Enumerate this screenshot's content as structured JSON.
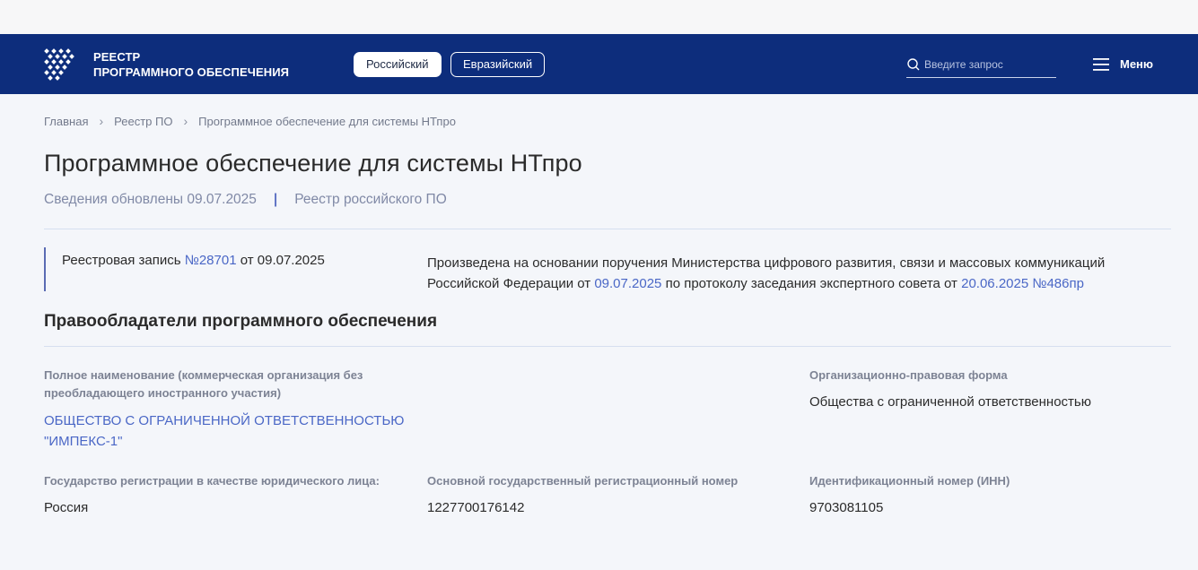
{
  "header": {
    "logo_text_line1": "РЕЕСТР",
    "logo_text_line2": "ПРОГРАММНОГО ОБЕСПЕЧЕНИЯ",
    "registry_tabs": [
      {
        "label": "Российский",
        "active": true
      },
      {
        "label": "Евразийский",
        "active": false
      }
    ],
    "search": {
      "placeholder": "Введите запрос",
      "value": ""
    },
    "menu_label": "Меню"
  },
  "breadcrumb": [
    "Главная",
    "Реестр ПО",
    "Программное обеспечение для системы НТпро"
  ],
  "page": {
    "title": "Программное обеспечение для системы НТпро",
    "updated": "Сведения обновлены 09.07.2025",
    "meta_divider": "|",
    "registry_name": "Реестр российского ПО"
  },
  "record": {
    "prefix": "Реестровая запись ",
    "number": "№28701",
    "suffix": " от 09.07.2025",
    "basis_part1": "Произведена на основании поручения Министерства цифрового развития, связи и массовых коммуникаций Российской Федерации от ",
    "basis_date": "09.07.2025",
    "basis_part2": " по протоколу заседания экспертного совета от ",
    "basis_protocol": "20.06.2025 №486пр"
  },
  "rightholders": {
    "section_title": "Правообладатели программного обеспечения",
    "full_name_label": "Полное наименование (коммерческая организация без преобладающего иностранного участия)",
    "full_name_value": "ОБЩЕСТВО С ОГРАНИЧЕННОЙ ОТВЕТСТВЕННОСТЬЮ \"ИМПЕКС-1\"",
    "legal_form_label": "Организационно-правовая форма",
    "legal_form_value": "Общества с ограниченной ответственностью",
    "country_label": "Государство регистрации в качестве юридического лица:",
    "country_value": "Россия",
    "ogrn_label": "Основной государственный регистрационный номер",
    "ogrn_value": "1227700176142",
    "inn_label": "Идентификационный номер (ИНН)",
    "inn_value": "9703081105"
  },
  "colors": {
    "header_bg": "#0d2d7c",
    "link": "#4a67c6",
    "page_bg": "#f4f6fa"
  }
}
